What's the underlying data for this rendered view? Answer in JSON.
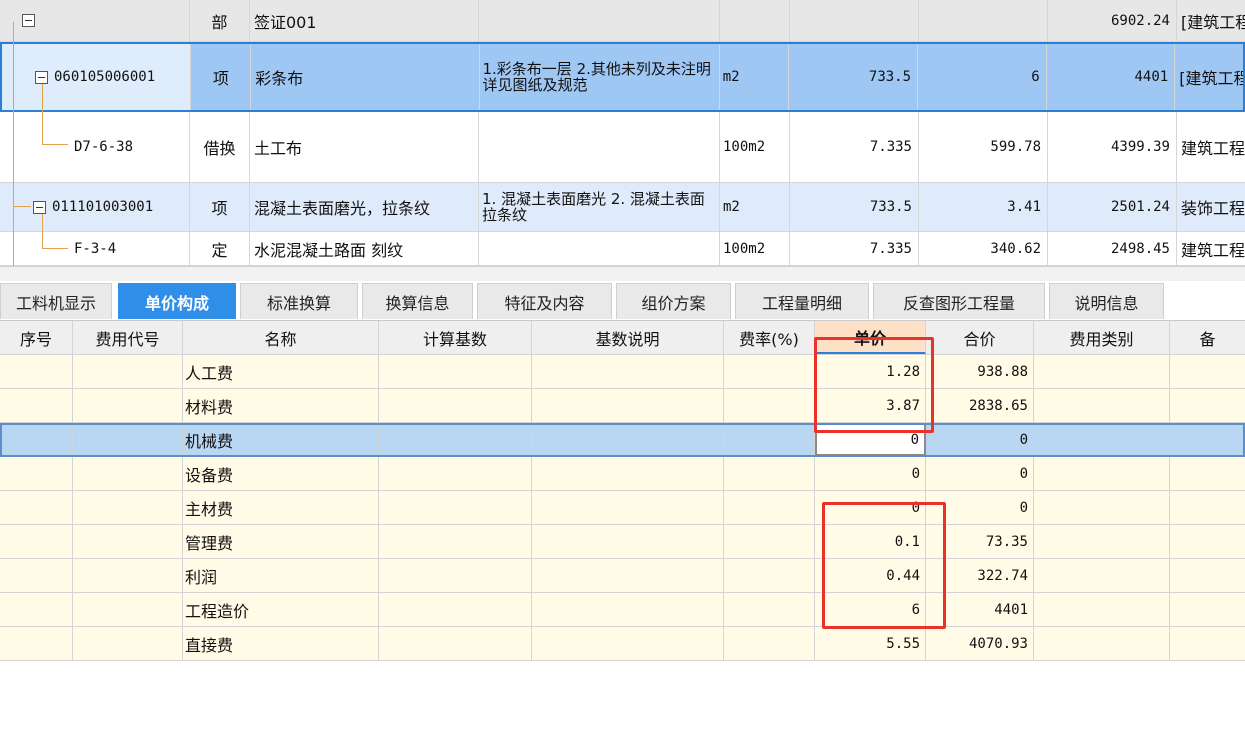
{
  "top_rows": [
    {
      "code": "",
      "type": "部",
      "name": "签证001",
      "feature": "",
      "unit": "",
      "qty": "",
      "price": "",
      "total": "6902.24",
      "prof": "[建筑工程"
    },
    {
      "code": "060105006001",
      "type": "项",
      "name": "彩条布",
      "feature": "1.彩条布一层\n2.其他未列及未注明详见图纸及规范",
      "unit": "m2",
      "qty": "733.5",
      "price": "6",
      "total": "4401",
      "prof": "[建筑工程"
    },
    {
      "code": "D7-6-38",
      "type": "借换",
      "name": "土工布",
      "feature": "",
      "unit": "100m2",
      "qty": "7.335",
      "price": "599.78",
      "total": "4399.39",
      "prof": "建筑工程"
    },
    {
      "code": "011101003001",
      "type": "项",
      "name": "混凝土表面磨光，拉条纹",
      "feature": "1. 混凝土表面磨光\n2. 混凝土表面拉条纹",
      "unit": "m2",
      "qty": "733.5",
      "price": "3.41",
      "total": "2501.24",
      "prof": "装饰工程"
    },
    {
      "code": "F-3-4",
      "type": "定",
      "name": "水泥混凝土路面 刻纹",
      "feature": "",
      "unit": "100m2",
      "qty": "7.335",
      "price": "340.62",
      "total": "2498.45",
      "prof": "建筑工程"
    }
  ],
  "tabs": [
    "工料机显示",
    "单价构成",
    "标准换算",
    "换算信息",
    "特征及内容",
    "组价方案",
    "工程量明细",
    "反查图形工程量",
    "说明信息"
  ],
  "active_tab": "单价构成",
  "columns": {
    "seq": "序号",
    "code": "费用代号",
    "name": "名称",
    "base": "计算基数",
    "desc": "基数说明",
    "rate": "费率(%)",
    "unit_price": "单价",
    "sum": "合价",
    "category": "费用类别",
    "rest": "备"
  },
  "rows": [
    {
      "name": "人工费",
      "unit_price": "1.28",
      "sum": "938.88"
    },
    {
      "name": "材料费",
      "unit_price": "3.87",
      "sum": "2838.65"
    },
    {
      "name": "机械费",
      "unit_price": "0",
      "sum": "0"
    },
    {
      "name": "设备费",
      "unit_price": "0",
      "sum": "0"
    },
    {
      "name": "主材费",
      "unit_price": "0",
      "sum": "0"
    },
    {
      "name": "管理费",
      "unit_price": "0.1",
      "sum": "73.35"
    },
    {
      "name": "利润",
      "unit_price": "0.44",
      "sum": "322.74"
    },
    {
      "name": "工程造价",
      "unit_price": "6",
      "sum": "4401"
    },
    {
      "name": "直接费",
      "unit_price": "5.55",
      "sum": "4070.93"
    }
  ],
  "selected_row": 2,
  "colors": {
    "highlight_box": "#e8322a",
    "tab_active": "#2f8ee8",
    "selected_row": "#b9d6f3"
  }
}
